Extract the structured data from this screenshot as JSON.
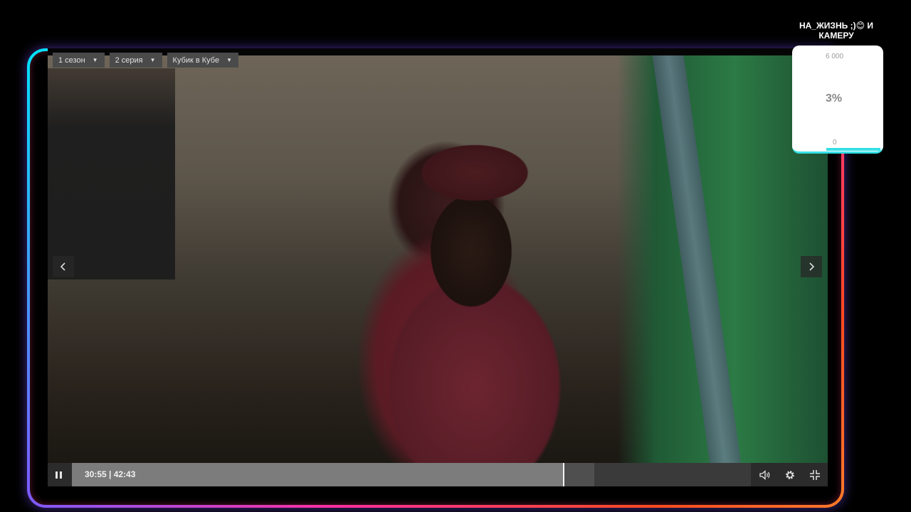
{
  "player": {
    "season_selector": "1 сезон",
    "episode_selector": "2 серия",
    "translation_selector": "Кубик в Кубе",
    "nav_prev_icon": "chevron-left-icon",
    "nav_next_icon": "chevron-right-icon",
    "current_time": "30:55",
    "duration": "42:43",
    "time_text": "30:55 | 42:43",
    "progress_fraction": 0.724,
    "buffered_fraction": 0.769,
    "controls": {
      "play_state": "pause-icon",
      "volume": "volume-icon",
      "settings": "gear-icon",
      "fullscreen": "exit-fullscreen-icon"
    }
  },
  "stream_overlay": {
    "title": "НА_ЖИЗНЬ ;)😊 И КАМЕРУ",
    "goal_max": "6 000",
    "goal_percent": "3%",
    "goal_min": "0",
    "accent_color": "#36e0e6"
  },
  "frame_colors": {
    "neon_left": "#00e5ff",
    "neon_mid": "#ff2fa0",
    "neon_right": "#ff4a1f"
  }
}
